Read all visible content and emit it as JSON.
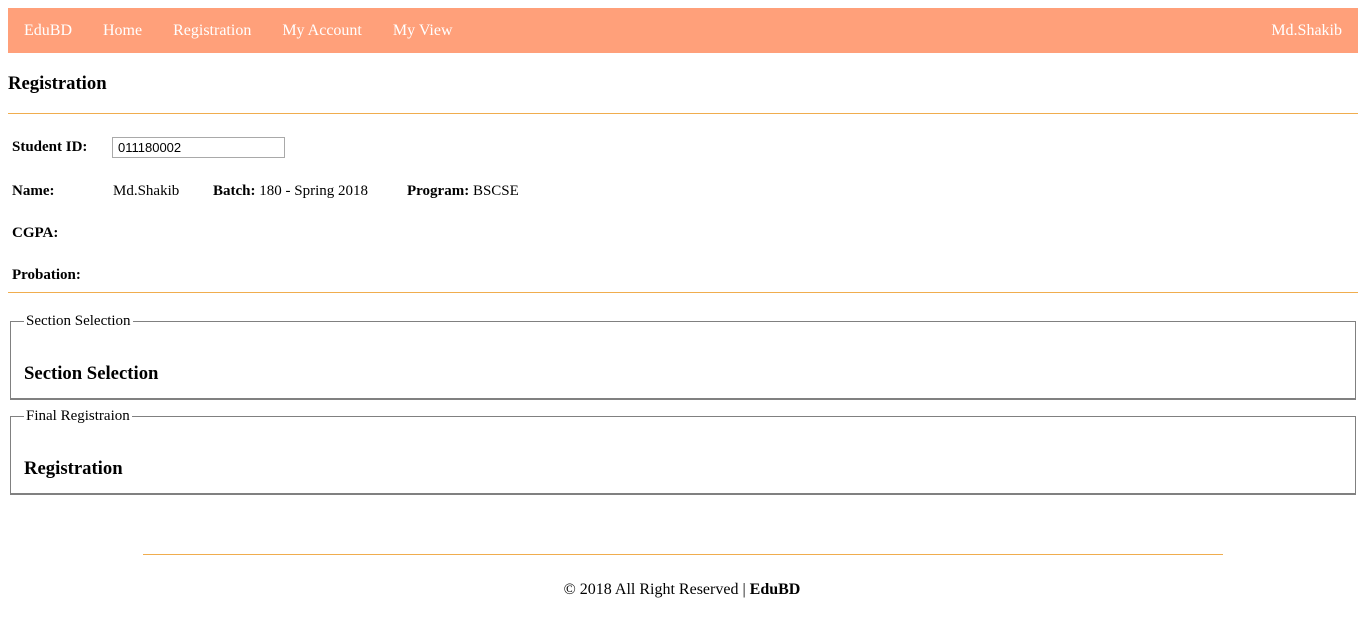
{
  "colors": {
    "navbar_bg": "#ffa07a",
    "rule": "#f0ad4e"
  },
  "navbar": {
    "brand": "EduBD",
    "links": [
      "Home",
      "Registration",
      "My Account",
      "My View"
    ],
    "user": "Md.Shakib"
  },
  "page": {
    "title": "Registration"
  },
  "student": {
    "id_label": "Student ID:",
    "id_value": "011180002",
    "name_label": "Name:",
    "name_value": "Md.Shakib",
    "batch_label": "Batch:",
    "batch_value": "180 - Spring 2018",
    "program_label": "Program:",
    "program_value": "BSCSE",
    "cgpa_label": "CGPA:",
    "probation_label": "Probation:"
  },
  "section_selection": {
    "legend": "Section Selection",
    "heading": "Section Selection"
  },
  "final_registration": {
    "legend": "Final Registraion",
    "heading": "Registration"
  },
  "footer": {
    "text": "© 2018 All Right Reserved | ",
    "brand": "EduBD"
  }
}
